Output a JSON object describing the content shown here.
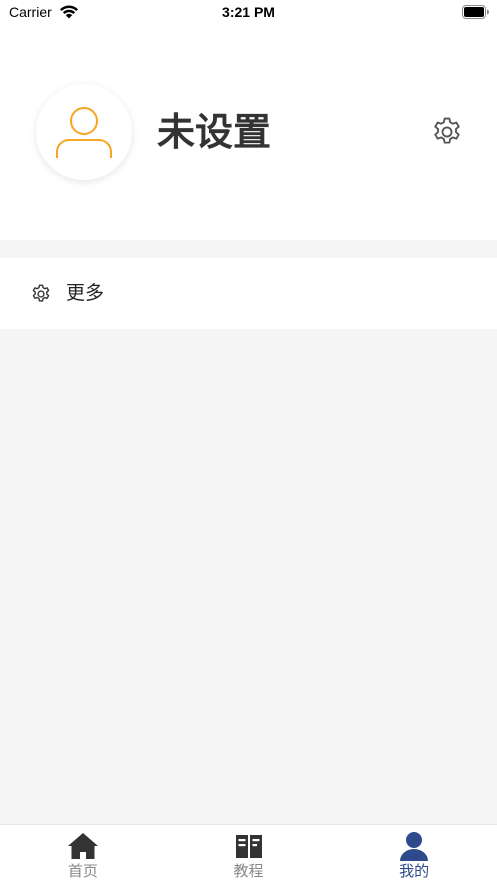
{
  "status_bar": {
    "carrier": "Carrier",
    "time": "3:21 PM"
  },
  "profile": {
    "name": "未设置",
    "avatar_color": "#f5a623"
  },
  "menu": {
    "items": [
      {
        "label": "更多",
        "icon": "gear-icon"
      }
    ]
  },
  "tab_bar": {
    "tabs": [
      {
        "label": "首页",
        "icon": "home-icon",
        "active": false
      },
      {
        "label": "教程",
        "icon": "book-icon",
        "active": false
      },
      {
        "label": "我的",
        "icon": "user-icon",
        "active": true
      }
    ],
    "active_color": "#2e4a8c",
    "inactive_color": "#888888"
  }
}
